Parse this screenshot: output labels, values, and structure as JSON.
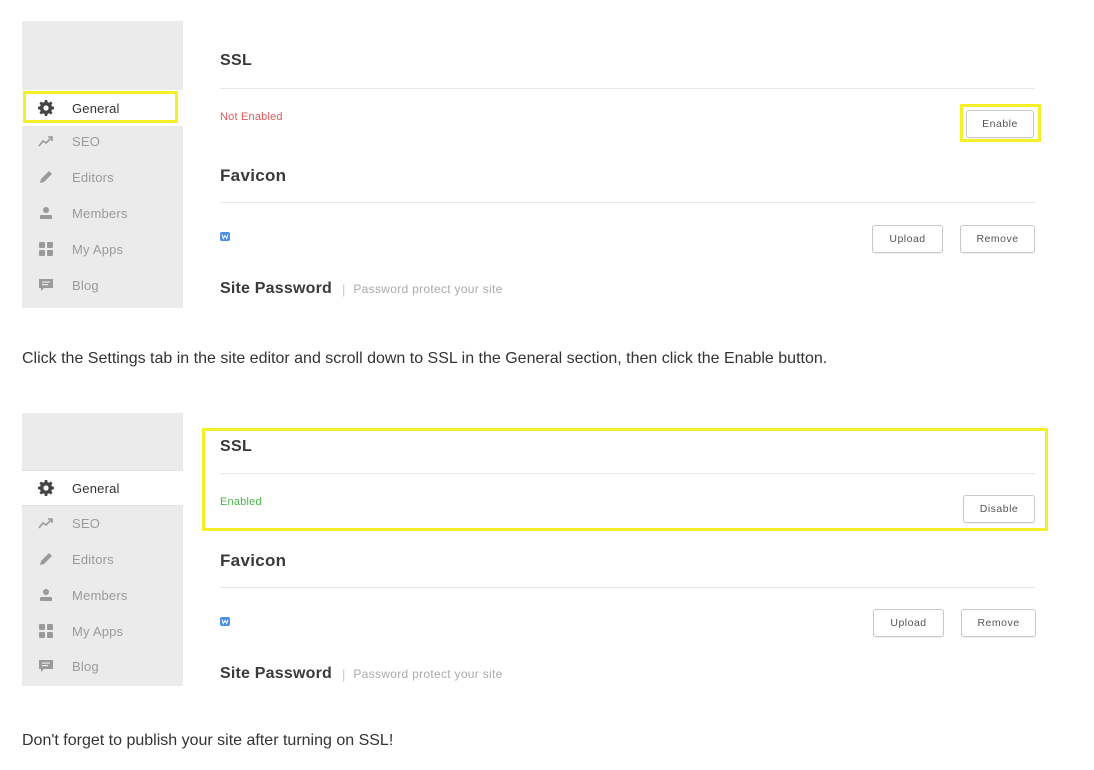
{
  "nav_items": [
    {
      "label": "General",
      "icon": "gear-icon"
    },
    {
      "label": "SEO",
      "icon": "trend-icon"
    },
    {
      "label": "Editors",
      "icon": "pencil-icon"
    },
    {
      "label": "Members",
      "icon": "user-icon"
    },
    {
      "label": "My Apps",
      "icon": "apps-grid-icon"
    },
    {
      "label": "Blog",
      "icon": "blog-icon"
    }
  ],
  "screenshot1": {
    "ssl_title": "SSL",
    "ssl_status": "Not Enabled",
    "ssl_button": "Enable",
    "favicon_title": "Favicon",
    "upload_button": "Upload",
    "remove_button": "Remove",
    "password_title": "Site Password",
    "password_separator": "|",
    "password_desc": "Password protect your site"
  },
  "screenshot2": {
    "ssl_title": "SSL",
    "ssl_status": "Enabled",
    "ssl_button": "Disable",
    "favicon_title": "Favicon",
    "upload_button": "Upload",
    "remove_button": "Remove",
    "password_title": "Site Password",
    "password_separator": "|",
    "password_desc": "Password protect your site"
  },
  "captions": {
    "step1": "Click the Settings tab in the site editor and scroll down to SSL in the General section, then click the Enable button.",
    "step2": "Don't forget to publish your site after turning on SSL!"
  },
  "colors": {
    "highlight": "#f5ef2a",
    "status_off": "#e05a5a",
    "status_on": "#4cb24c",
    "favicon": "#4a90e2"
  }
}
